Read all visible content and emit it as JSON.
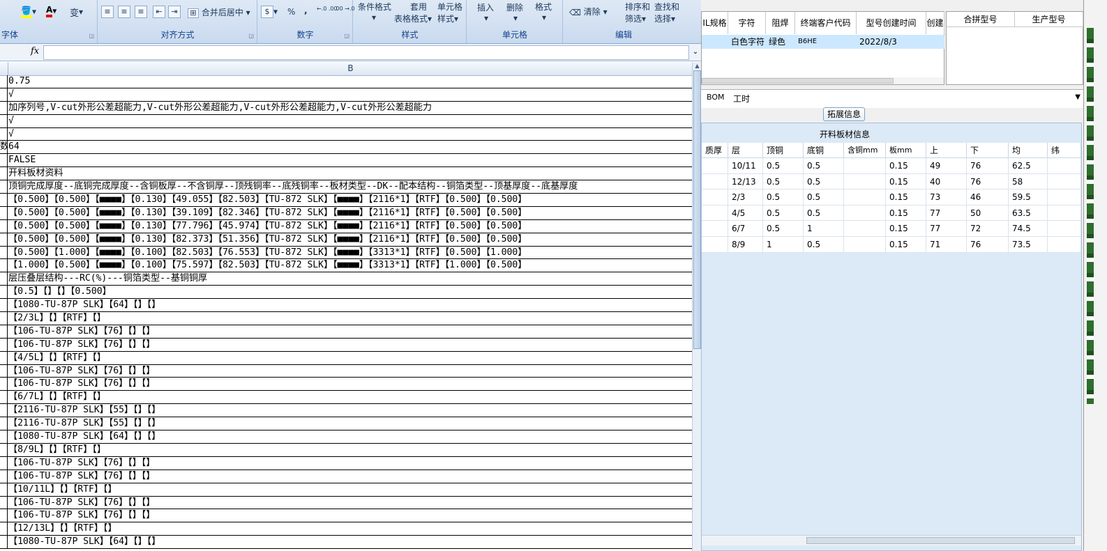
{
  "excel": {
    "ribbon": {
      "font_group_label": "字体",
      "align_merge_label": "合并后居中",
      "align_group_label": "对齐方式",
      "number_percent": "%",
      "number_comma": ",",
      "number_inc": "←.0 .00",
      "number_dec": ".00 →.0",
      "number_group_label": "数字",
      "conditional_format": "条件格式",
      "table_format_1": "套用",
      "table_format_2": "表格格式",
      "cell_style_1": "单元格",
      "cell_style_2": "样式",
      "style_group_label": "样式",
      "insert": "插入",
      "delete": "删除",
      "format": "格式",
      "cells_group_label": "单元格",
      "clear": "清除",
      "sort_filter_1": "排序和",
      "sort_filter_2": "筛选",
      "find_select_1": "查找和",
      "find_select_2": "选择",
      "edit_group_label": "编辑"
    },
    "formula_bar": {
      "fx": "fx",
      "value": ""
    },
    "column_header": "B",
    "rows": [
      {
        "a": "",
        "b": "0.75"
      },
      {
        "a": "",
        "b": "√"
      },
      {
        "a": "",
        "b": "加序列号,V-cut外形公差超能力,V-cut外形公差超能力,V-cut外形公差超能力,V-cut外形公差超能力"
      },
      {
        "a": "",
        "b": "√"
      },
      {
        "a": "",
        "b": "√"
      },
      {
        "a": "数",
        "b": "64"
      },
      {
        "a": "",
        "b": "FALSE"
      },
      {
        "a": "",
        "b": "开料板材资料"
      },
      {
        "a": "",
        "b": "顶铜完成厚度--底铜完成厚度--含铜板厚--不含铜厚--顶残铜率--底残铜率--板材类型--DK--配本结构--铜箔类型--顶基厚度--底基厚度"
      },
      {
        "a": "",
        "b": "【0.500】【0.500】【■■■■】【0.130】【49.055】【82.503】【TU-872 SLK】【■■■■】【2116*1】【RTF】【0.500】【0.500】"
      },
      {
        "a": "",
        "b": "【0.500】【0.500】【■■■■】【0.130】【39.109】【82.346】【TU-872 SLK】【■■■■】【2116*1】【RTF】【0.500】【0.500】"
      },
      {
        "a": "",
        "b": "【0.500】【0.500】【■■■■】【0.130】【77.796】【45.974】【TU-872 SLK】【■■■■】【2116*1】【RTF】【0.500】【0.500】"
      },
      {
        "a": "",
        "b": "【0.500】【0.500】【■■■■】【0.130】【82.373】【51.356】【TU-872 SLK】【■■■■】【2116*1】【RTF】【0.500】【0.500】"
      },
      {
        "a": "",
        "b": "【0.500】【1.000】【■■■■】【0.100】【82.503】【76.553】【TU-872 SLK】【■■■■】【3313*1】【RTF】【0.500】【1.000】"
      },
      {
        "a": "",
        "b": "【1.000】【0.500】【■■■■】【0.100】【75.597】【82.503】【TU-872 SLK】【■■■■】【3313*1】【RTF】【1.000】【0.500】"
      },
      {
        "a": "",
        "b": "层压叠层结构---RC(%)---铜箔类型--基铜铜厚"
      },
      {
        "a": "",
        "b": "【0.5】【】【】【0.500】"
      },
      {
        "a": "",
        "b": "【1080-TU-87P SLK】【64】【】【】"
      },
      {
        "a": "",
        "b": "【2/3L】【】【RTF】【】"
      },
      {
        "a": "",
        "b": "【106-TU-87P SLK】【76】【】【】"
      },
      {
        "a": "",
        "b": "【106-TU-87P SLK】【76】【】【】"
      },
      {
        "a": "",
        "b": "【4/5L】【】【RTF】【】"
      },
      {
        "a": "",
        "b": "【106-TU-87P SLK】【76】【】【】"
      },
      {
        "a": "",
        "b": "【106-TU-87P SLK】【76】【】【】"
      },
      {
        "a": "",
        "b": "【6/7L】【】【RTF】【】"
      },
      {
        "a": "",
        "b": "【2116-TU-87P SLK】【55】【】【】"
      },
      {
        "a": "",
        "b": "【2116-TU-87P SLK】【55】【】【】"
      },
      {
        "a": "",
        "b": "【1080-TU-87P SLK】【64】【】【】"
      },
      {
        "a": "",
        "b": "【8/9L】【】【RTF】【】"
      },
      {
        "a": "",
        "b": "【106-TU-87P SLK】【76】【】【】"
      },
      {
        "a": "",
        "b": "【106-TU-87P SLK】【76】【】【】"
      },
      {
        "a": "",
        "b": "【10/11L】【】【RTF】【】"
      },
      {
        "a": "",
        "b": "【106-TU-87P SLK】【76】【】【】"
      },
      {
        "a": "",
        "b": "【106-TU-87P SLK】【76】【】【】"
      },
      {
        "a": "",
        "b": "【12/13L】【】【RTF】【】"
      },
      {
        "a": "",
        "b": "【1080-TU-87P SLK】【64】【】【】"
      }
    ]
  },
  "app": {
    "grid1": {
      "headers": [
        "IL规格",
        "字符",
        "阻焊",
        "终端客户代码",
        "型号创建时间",
        "创建"
      ],
      "row": [
        "",
        "白色字符",
        "绿色",
        "B6HE",
        "2022/8/3",
        ""
      ]
    },
    "grid2": {
      "headers": [
        "合拼型号",
        "生产型号"
      ]
    },
    "tabs": [
      "BOM",
      "工时"
    ],
    "expand_button": "拓展信息",
    "panel": {
      "title": "开料板材信息",
      "headers": [
        "质厚度",
        "层",
        "顶铜",
        "底铜",
        "含铜mm",
        "板mm",
        "上",
        "下",
        "均",
        "纬"
      ],
      "rows": [
        [
          "",
          "10/11",
          "0.5",
          "0.5",
          "",
          "0.15",
          "49",
          "76",
          "62.5",
          ""
        ],
        [
          "",
          "12/13",
          "0.5",
          "0.5",
          "",
          "0.15",
          "40",
          "76",
          "58",
          ""
        ],
        [
          "",
          "2/3",
          "0.5",
          "0.5",
          "",
          "0.15",
          "73",
          "46",
          "59.5",
          ""
        ],
        [
          "",
          "4/5",
          "0.5",
          "0.5",
          "",
          "0.15",
          "77",
          "50",
          "63.5",
          ""
        ],
        [
          "",
          "6/7",
          "0.5",
          "1",
          "",
          "0.15",
          "77",
          "72",
          "74.5",
          ""
        ],
        [
          "",
          "8/9",
          "1",
          "0.5",
          "",
          "0.15",
          "71",
          "76",
          "73.5",
          ""
        ]
      ]
    }
  }
}
